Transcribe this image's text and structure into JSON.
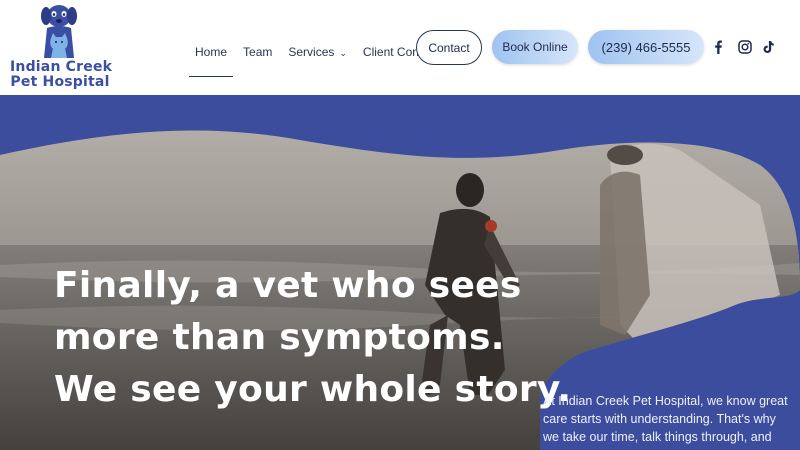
{
  "brand": {
    "line1": "Indian Creek",
    "line2": "Pet Hospital",
    "logo_icon": "dog-cat-logo-icon",
    "color": "#3a4fa3"
  },
  "nav": {
    "items": [
      {
        "label": "Home",
        "active": true
      },
      {
        "label": "Team"
      },
      {
        "label": "Services",
        "dropdown": true
      },
      {
        "label": "Client Corner",
        "dropdown": true
      }
    ]
  },
  "actions": {
    "contact_label": "Contact",
    "book_label": "Book Online",
    "phone_label": "(239) 466-5555"
  },
  "social": [
    "facebook-icon",
    "instagram-icon",
    "tiktok-icon"
  ],
  "hero": {
    "headline": "Finally, a vet who sees more than symptoms. We see your whole story.",
    "intro": "At Indian Creek Pet Hospital, we know great care starts with understanding. That's why we take our time, talk things through, and create",
    "background_color": "#3b4d9c"
  }
}
